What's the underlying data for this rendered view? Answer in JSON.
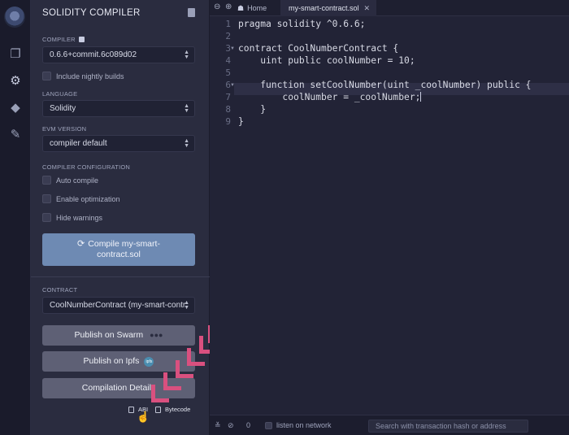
{
  "rail": {
    "icons": [
      "remix-logo-icon",
      "file-explorer-icon",
      "solidity-compiler-icon",
      "deploy-run-icon",
      "plugin-manager-icon"
    ]
  },
  "sidebar": {
    "title": "SOLIDITY COMPILER",
    "compiler_label": "COMPILER",
    "compiler_value": "0.6.6+commit.6c089d02",
    "nightly_label": "Include nightly builds",
    "language_label": "LANGUAGE",
    "language_value": "Solidity",
    "evm_label": "EVM VERSION",
    "evm_value": "compiler default",
    "config_label": "COMPILER CONFIGURATION",
    "auto_compile": "Auto compile",
    "enable_optimization": "Enable optimization",
    "hide_warnings": "Hide warnings",
    "compile_button_line1": "Compile my-smart-",
    "compile_button_line2": "contract.sol",
    "contract_label": "CONTRACT",
    "contract_value": "CoolNumberContract (my-smart-contr",
    "publish_swarm": "Publish on Swarm",
    "publish_ipfs": "Publish on Ipfs",
    "ipfs_badge": "ipfs",
    "compilation_details": "Compilation Details",
    "abi": "ABI",
    "bytecode": "Bytecode"
  },
  "editor": {
    "home_tab": "Home",
    "file_tab": "my-smart-contract.sol",
    "close_glyph": "✕",
    "line_numbers": [
      "1",
      "2",
      "3",
      "4",
      "5",
      "6",
      "7",
      "8",
      "9"
    ],
    "lines": [
      "pragma solidity ^0.6.6;",
      "",
      "contract CoolNumberContract {",
      "    uint public coolNumber = 10;",
      "",
      "    function setCoolNumber(uint _coolNumber) public {",
      "        coolNumber = _coolNumber;",
      "    }",
      "}"
    ]
  },
  "footer": {
    "count": "0",
    "listen_label": "listen on network",
    "search_placeholder": "Search with transaction hash or address"
  },
  "colors": {
    "accent_compile": "#6e8ab3",
    "arrow": "#d9507f"
  }
}
